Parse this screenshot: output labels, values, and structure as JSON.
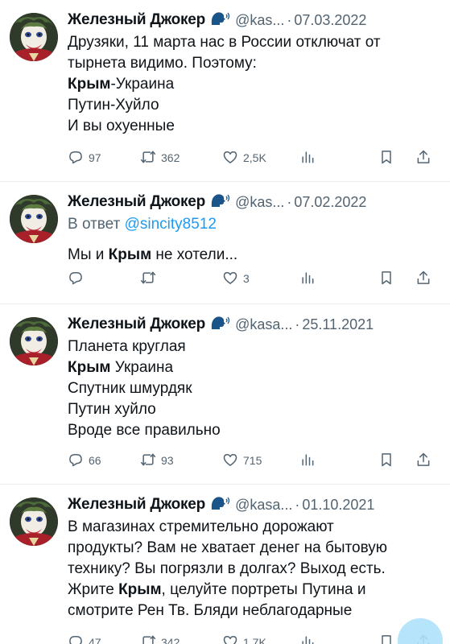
{
  "tweets": [
    {
      "name": "Железный Джокер",
      "handle": "@kas...",
      "separator": "·",
      "date": "07.03.2022",
      "lines": [
        [
          {
            "t": "Друзяки, 11 марта нас в России отключат от",
            "b": false
          }
        ],
        [
          {
            "t": "тырнета видимо. Поэтому:",
            "b": false
          }
        ],
        [
          {
            "t": "Крым",
            "b": true
          },
          {
            "t": "-Украина",
            "b": false
          }
        ],
        [
          {
            "t": "Путин-Хуйло",
            "b": false
          }
        ],
        [
          {
            "t": "И вы охуенные",
            "b": false
          }
        ]
      ],
      "counts": {
        "replies": "97",
        "retweets": "362",
        "likes": "2,5K"
      }
    },
    {
      "name": "Железный Джокер",
      "handle": "@kas...",
      "separator": "·",
      "date": "07.02.2022",
      "reply_prefix": "В ответ",
      "reply_to": "@sincity8512",
      "lines": [
        [
          {
            "t": "Мы и ",
            "b": false
          },
          {
            "t": "Крым",
            "b": true
          },
          {
            "t": " не хотели...",
            "b": false
          }
        ]
      ],
      "counts": {
        "replies": "",
        "retweets": "",
        "likes": "3"
      }
    },
    {
      "name": "Железный Джокер",
      "handle": "@kasa...",
      "separator": "·",
      "date": "25.11.2021",
      "lines": [
        [
          {
            "t": "Планета круглая",
            "b": false
          }
        ],
        [
          {
            "t": "Крым",
            "b": true
          },
          {
            "t": " Украина",
            "b": false
          }
        ],
        [
          {
            "t": "Спутник шмурдяк",
            "b": false
          }
        ],
        [
          {
            "t": "Путин хуйло",
            "b": false
          }
        ],
        [
          {
            "t": "Вроде все правильно",
            "b": false
          }
        ]
      ],
      "counts": {
        "replies": "66",
        "retweets": "93",
        "likes": "715"
      }
    },
    {
      "name": "Железный Джокер",
      "handle": "@kasa...",
      "separator": "·",
      "date": "01.10.2021",
      "lines": [
        [
          {
            "t": "В магазинах стремительно дорожают",
            "b": false
          }
        ],
        [
          {
            "t": "продукты? Вам не хватает денег на бытовую",
            "b": false
          }
        ],
        [
          {
            "t": "технику? Вы погрязли в долгах? Выход есть.",
            "b": false
          }
        ],
        [
          {
            "t": "Жрите ",
            "b": false
          },
          {
            "t": "Крым",
            "b": true
          },
          {
            "t": ", целуйте портреты Путина и",
            "b": false
          }
        ],
        [
          {
            "t": "смотрите Рен Тв. Бляди неблагодарные",
            "b": false
          }
        ]
      ],
      "counts": {
        "replies": "47",
        "retweets": "342",
        "likes": "1,7K"
      }
    }
  ],
  "icons": {
    "badge": "speaking-head-icon",
    "reply": "reply-icon",
    "retweet": "retweet-icon",
    "like": "heart-icon",
    "views": "views-icon",
    "bookmark": "bookmark-icon",
    "share": "share-icon"
  },
  "colors": {
    "mention": "#1d9bf0",
    "secondary": "#536471",
    "divider": "#e6ecf0",
    "fab": "#aee1f9"
  }
}
